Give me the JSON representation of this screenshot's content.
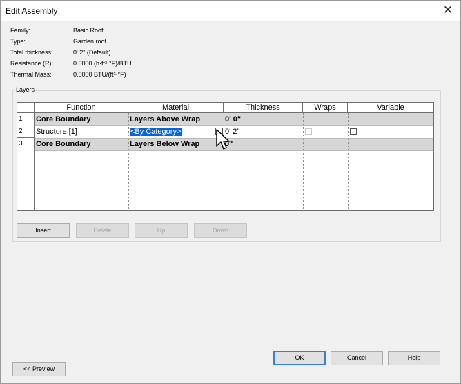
{
  "window": {
    "title": "Edit Assembly",
    "close_glyph": "✕"
  },
  "properties": [
    {
      "label": "Family:",
      "value": "Basic Roof"
    },
    {
      "label": "Type:",
      "value": "Garden roof"
    },
    {
      "label": "Total thickness:",
      "value": "0'  2\" (Default)"
    },
    {
      "label": "Resistance (R):",
      "value": "0.0000 (h·ft²·°F)/BTU"
    },
    {
      "label": "Thermal Mass:",
      "value": "0.0000 BTU/(ft²·°F)"
    }
  ],
  "layers": {
    "group_label": "Layers",
    "columns": [
      "Function",
      "Material",
      "Thickness",
      "Wraps",
      "Variable"
    ],
    "rows": [
      {
        "num": "1",
        "function": "Core Boundary",
        "material": "Layers Above Wrap",
        "thickness": "0'  0\""
      },
      {
        "num": "2",
        "function": "Structure [1]",
        "material": "<By Category>",
        "thickness": "0'  2\""
      },
      {
        "num": "3",
        "function": "Core Boundary",
        "material": "Layers Below Wrap",
        "thickness": "  0\""
      }
    ],
    "buttons": {
      "insert": "Insert",
      "delete": "Delete",
      "up": "Up",
      "down": "Down"
    }
  },
  "footer": {
    "preview": "<< Preview",
    "ok": "OK",
    "cancel": "Cancel",
    "help": "Help"
  },
  "colors": {
    "selection": "#0a64d8",
    "shaded_row": "#d6d6d6",
    "dialog_bg": "#f0f0f0"
  }
}
